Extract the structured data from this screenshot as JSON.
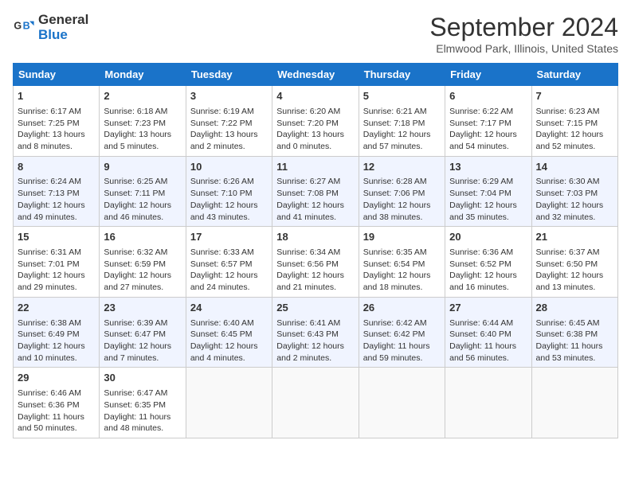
{
  "header": {
    "logo_line1": "General",
    "logo_line2": "Blue",
    "month": "September 2024",
    "location": "Elmwood Park, Illinois, United States"
  },
  "weekdays": [
    "Sunday",
    "Monday",
    "Tuesday",
    "Wednesday",
    "Thursday",
    "Friday",
    "Saturday"
  ],
  "weeks": [
    [
      {
        "day": "1",
        "info": "Sunrise: 6:17 AM\nSunset: 7:25 PM\nDaylight: 13 hours\nand 8 minutes."
      },
      {
        "day": "2",
        "info": "Sunrise: 6:18 AM\nSunset: 7:23 PM\nDaylight: 13 hours\nand 5 minutes."
      },
      {
        "day": "3",
        "info": "Sunrise: 6:19 AM\nSunset: 7:22 PM\nDaylight: 13 hours\nand 2 minutes."
      },
      {
        "day": "4",
        "info": "Sunrise: 6:20 AM\nSunset: 7:20 PM\nDaylight: 13 hours\nand 0 minutes."
      },
      {
        "day": "5",
        "info": "Sunrise: 6:21 AM\nSunset: 7:18 PM\nDaylight: 12 hours\nand 57 minutes."
      },
      {
        "day": "6",
        "info": "Sunrise: 6:22 AM\nSunset: 7:17 PM\nDaylight: 12 hours\nand 54 minutes."
      },
      {
        "day": "7",
        "info": "Sunrise: 6:23 AM\nSunset: 7:15 PM\nDaylight: 12 hours\nand 52 minutes."
      }
    ],
    [
      {
        "day": "8",
        "info": "Sunrise: 6:24 AM\nSunset: 7:13 PM\nDaylight: 12 hours\nand 49 minutes."
      },
      {
        "day": "9",
        "info": "Sunrise: 6:25 AM\nSunset: 7:11 PM\nDaylight: 12 hours\nand 46 minutes."
      },
      {
        "day": "10",
        "info": "Sunrise: 6:26 AM\nSunset: 7:10 PM\nDaylight: 12 hours\nand 43 minutes."
      },
      {
        "day": "11",
        "info": "Sunrise: 6:27 AM\nSunset: 7:08 PM\nDaylight: 12 hours\nand 41 minutes."
      },
      {
        "day": "12",
        "info": "Sunrise: 6:28 AM\nSunset: 7:06 PM\nDaylight: 12 hours\nand 38 minutes."
      },
      {
        "day": "13",
        "info": "Sunrise: 6:29 AM\nSunset: 7:04 PM\nDaylight: 12 hours\nand 35 minutes."
      },
      {
        "day": "14",
        "info": "Sunrise: 6:30 AM\nSunset: 7:03 PM\nDaylight: 12 hours\nand 32 minutes."
      }
    ],
    [
      {
        "day": "15",
        "info": "Sunrise: 6:31 AM\nSunset: 7:01 PM\nDaylight: 12 hours\nand 29 minutes."
      },
      {
        "day": "16",
        "info": "Sunrise: 6:32 AM\nSunset: 6:59 PM\nDaylight: 12 hours\nand 27 minutes."
      },
      {
        "day": "17",
        "info": "Sunrise: 6:33 AM\nSunset: 6:57 PM\nDaylight: 12 hours\nand 24 minutes."
      },
      {
        "day": "18",
        "info": "Sunrise: 6:34 AM\nSunset: 6:56 PM\nDaylight: 12 hours\nand 21 minutes."
      },
      {
        "day": "19",
        "info": "Sunrise: 6:35 AM\nSunset: 6:54 PM\nDaylight: 12 hours\nand 18 minutes."
      },
      {
        "day": "20",
        "info": "Sunrise: 6:36 AM\nSunset: 6:52 PM\nDaylight: 12 hours\nand 16 minutes."
      },
      {
        "day": "21",
        "info": "Sunrise: 6:37 AM\nSunset: 6:50 PM\nDaylight: 12 hours\nand 13 minutes."
      }
    ],
    [
      {
        "day": "22",
        "info": "Sunrise: 6:38 AM\nSunset: 6:49 PM\nDaylight: 12 hours\nand 10 minutes."
      },
      {
        "day": "23",
        "info": "Sunrise: 6:39 AM\nSunset: 6:47 PM\nDaylight: 12 hours\nand 7 minutes."
      },
      {
        "day": "24",
        "info": "Sunrise: 6:40 AM\nSunset: 6:45 PM\nDaylight: 12 hours\nand 4 minutes."
      },
      {
        "day": "25",
        "info": "Sunrise: 6:41 AM\nSunset: 6:43 PM\nDaylight: 12 hours\nand 2 minutes."
      },
      {
        "day": "26",
        "info": "Sunrise: 6:42 AM\nSunset: 6:42 PM\nDaylight: 11 hours\nand 59 minutes."
      },
      {
        "day": "27",
        "info": "Sunrise: 6:44 AM\nSunset: 6:40 PM\nDaylight: 11 hours\nand 56 minutes."
      },
      {
        "day": "28",
        "info": "Sunrise: 6:45 AM\nSunset: 6:38 PM\nDaylight: 11 hours\nand 53 minutes."
      }
    ],
    [
      {
        "day": "29",
        "info": "Sunrise: 6:46 AM\nSunset: 6:36 PM\nDaylight: 11 hours\nand 50 minutes."
      },
      {
        "day": "30",
        "info": "Sunrise: 6:47 AM\nSunset: 6:35 PM\nDaylight: 11 hours\nand 48 minutes."
      },
      null,
      null,
      null,
      null,
      null
    ]
  ]
}
